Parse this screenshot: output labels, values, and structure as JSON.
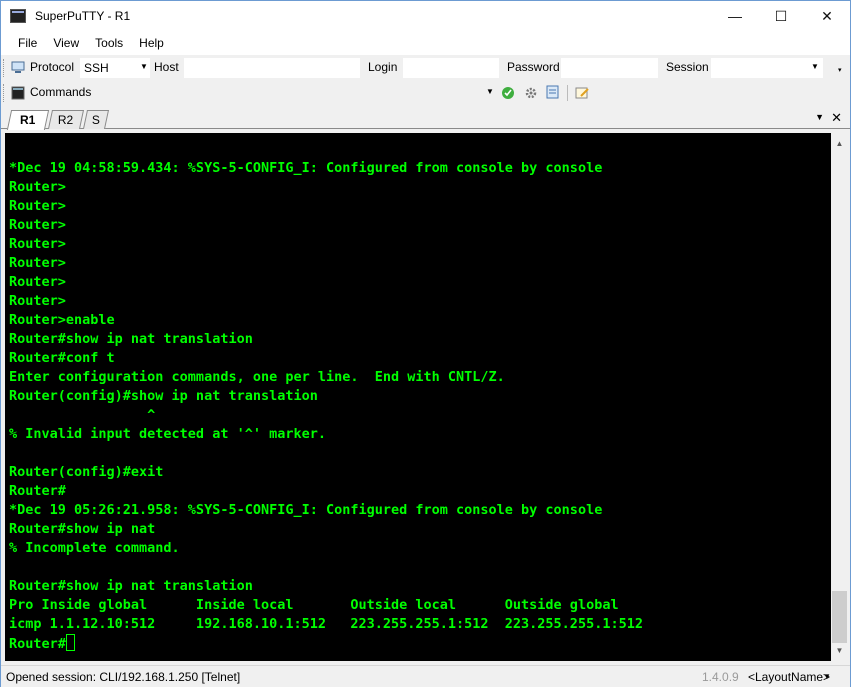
{
  "window": {
    "title": "SuperPuTTY - R1",
    "controls": {
      "minimize": "—",
      "maximize": "☐",
      "close": "✕"
    }
  },
  "menu": [
    "File",
    "View",
    "Tools",
    "Help"
  ],
  "toolbar": {
    "protocol_label": "Protocol",
    "protocol_value": "SSH",
    "host_label": "Host",
    "host_value": "",
    "login_label": "Login",
    "password_label": "Password",
    "session_label": "Session",
    "commands_label": "Commands"
  },
  "tabs": [
    {
      "label": "R1",
      "active": true
    },
    {
      "label": "R2",
      "active": false
    },
    {
      "label": "S",
      "active": false
    }
  ],
  "terminal": {
    "text_color": "#00ff00",
    "lines": [
      "*Dec 19 04:58:59.434: %SYS-5-CONFIG_I: Configured from console by console",
      "Router>",
      "Router>",
      "Router>",
      "Router>",
      "Router>",
      "Router>",
      "Router>",
      "Router>enable",
      "Router#show ip nat translation",
      "Router#conf t",
      "Enter configuration commands, one per line.  End with CNTL/Z.",
      "Router(config)#show ip nat translation",
      "                 ^",
      "% Invalid input detected at '^' marker.",
      "",
      "Router(config)#exit",
      "Router#",
      "*Dec 19 05:26:21.958: %SYS-5-CONFIG_I: Configured from console by console",
      "Router#show ip nat",
      "% Incomplete command.",
      "",
      "Router#show ip nat translation",
      "Pro Inside global      Inside local       Outside local      Outside global",
      "icmp 1.1.12.10:512     192.168.10.1:512   223.255.255.1:512  223.255.255.1:512"
    ],
    "prompt": "Router#"
  },
  "status": {
    "session": "Opened session: CLI/192.168.1.250 [Telnet]",
    "version": "1.4.0.9",
    "layout": "<LayoutName>"
  }
}
